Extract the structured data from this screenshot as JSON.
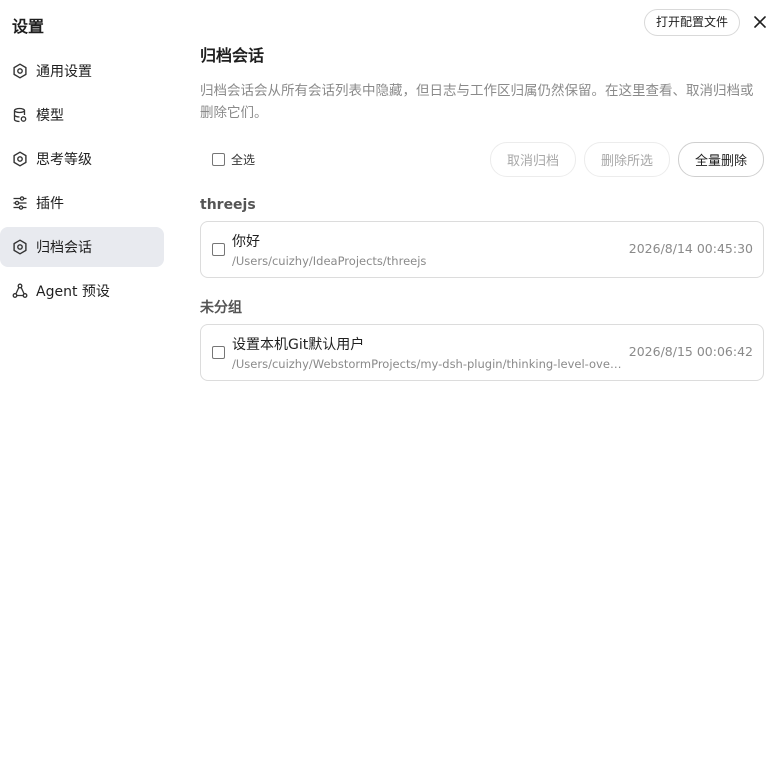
{
  "header": {
    "title": "设置",
    "open_config_label": "打开配置文件"
  },
  "sidebar": {
    "items": [
      {
        "label": "通用设置",
        "icon": "gear-icon",
        "active": false
      },
      {
        "label": "模型",
        "icon": "database-icon",
        "active": false
      },
      {
        "label": "思考等级",
        "icon": "gear-icon",
        "active": false
      },
      {
        "label": "插件",
        "icon": "sliders-icon",
        "active": false
      },
      {
        "label": "归档会话",
        "icon": "gear-icon",
        "active": true
      },
      {
        "label": "Agent 预设",
        "icon": "agent-icon",
        "active": false
      }
    ]
  },
  "main": {
    "title": "归档会话",
    "description": "归档会话会从所有会话列表中隐藏，但日志与工作区归属仍然保留。在这里查看、取消归档或删除它们。",
    "select_all_label": "全选",
    "buttons": {
      "unarchive": "取消归档",
      "delete_selected": "删除所选",
      "delete_all": "全量删除"
    },
    "groups": [
      {
        "label": "threejs",
        "items": [
          {
            "name": "你好",
            "path": "/Users/cuizhy/IdeaProjects/threejs",
            "time": "2026/8/14 00:45:30"
          }
        ]
      },
      {
        "label": "未分组",
        "items": [
          {
            "name": "设置本机Git默认用户",
            "path": "/Users/cuizhy/WebstormProjects/my-dsh-plugin/thinking-level-over...",
            "time": "2026/8/15 00:06:42"
          }
        ]
      }
    ]
  },
  "colors": {
    "active_nav_bg": "#e8eaef",
    "muted_text": "#8a8a8a",
    "border": "#dcdcdc"
  }
}
